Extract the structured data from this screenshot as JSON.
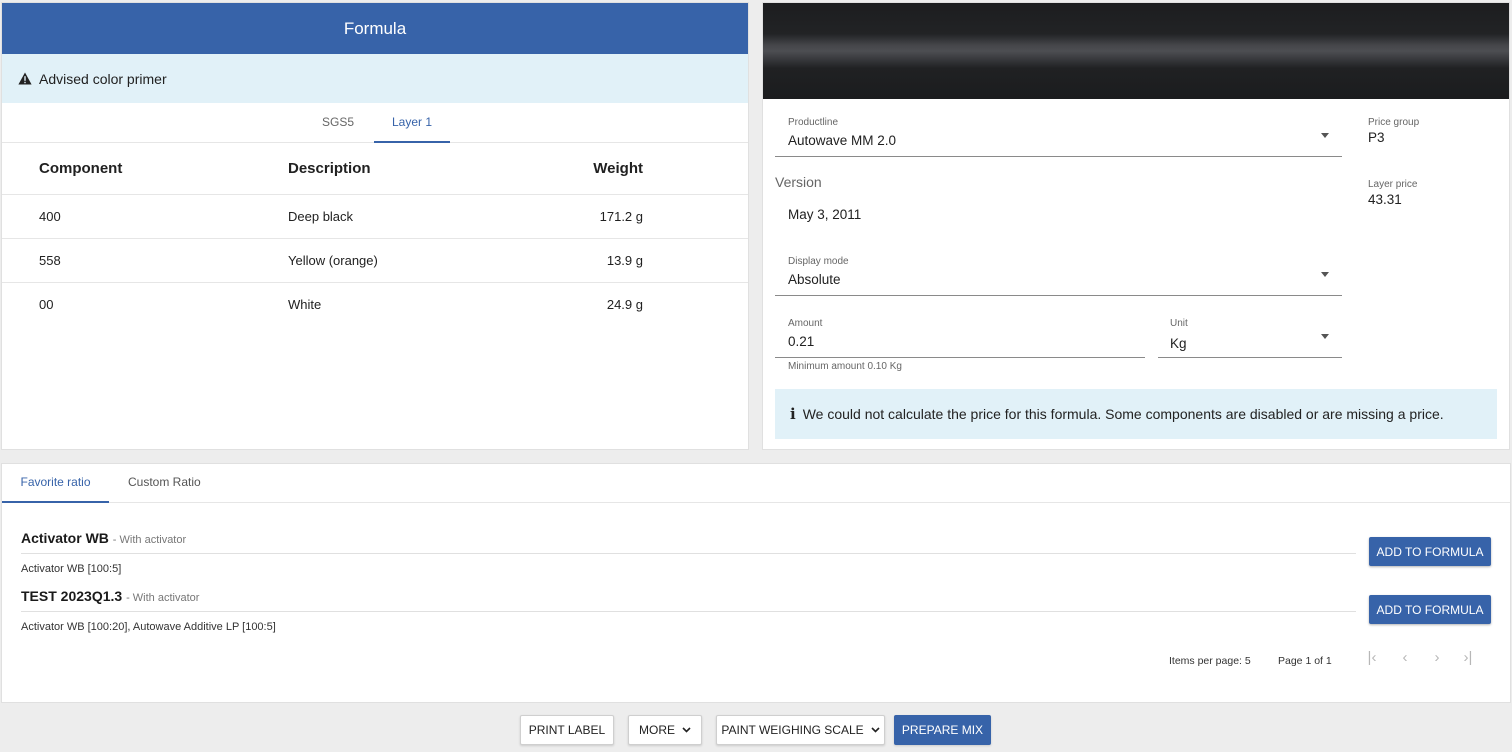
{
  "formula": {
    "title": "Formula",
    "advice": "Advised color primer",
    "tabs": [
      {
        "label": "SGS5"
      },
      {
        "label": "Layer 1"
      }
    ],
    "columns": {
      "component": "Component",
      "description": "Description",
      "weight": "Weight"
    },
    "rows": [
      {
        "component": "400",
        "description": "Deep black",
        "weight": "171.2 g"
      },
      {
        "component": "558",
        "description": "Yellow (orange)",
        "weight": "13.9 g"
      },
      {
        "component": "00",
        "description": "White",
        "weight": "24.9 g"
      }
    ]
  },
  "details": {
    "swatch_color": "#202123",
    "productline": {
      "label": "Productline",
      "value": "Autowave MM 2.0"
    },
    "version": {
      "label": "Version",
      "value": "May 3, 2011"
    },
    "display_mode": {
      "label": "Display mode",
      "value": "Absolute"
    },
    "amount": {
      "label": "Amount",
      "value": "0.21",
      "hint": "Minimum amount 0.10 Kg"
    },
    "unit": {
      "label": "Unit",
      "value": "Kg"
    },
    "price_group": {
      "label": "Price group",
      "value": "P3"
    },
    "layer_price": {
      "label": "Layer price",
      "value": "43.31"
    },
    "price_info": "We could not calculate the price for this formula. Some components are disabled or are missing a price."
  },
  "ratios": {
    "tabs": [
      {
        "label": "Favorite ratio"
      },
      {
        "label": "Custom Ratio"
      }
    ],
    "items": [
      {
        "name": "Activator WB",
        "sub": "- With activator",
        "detail": "Activator WB [100:5]",
        "button": "ADD TO FORMULA"
      },
      {
        "name": "TEST 2023Q1.3",
        "sub": "- With activator",
        "detail": "Activator WB [100:20], Autowave Additive LP [100:5]",
        "button": "ADD TO FORMULA"
      }
    ],
    "pager": {
      "items_per_page": "Items per page: 5",
      "page": "Page 1 of 1"
    }
  },
  "toolbar": {
    "print_label": "PRINT LABEL",
    "more": "MORE",
    "scale": "PAINT WEIGHING SCALE",
    "prepare": "PREPARE MIX"
  },
  "colors": {
    "accent": "#3763a9",
    "info_bg": "#e1f1f8"
  }
}
